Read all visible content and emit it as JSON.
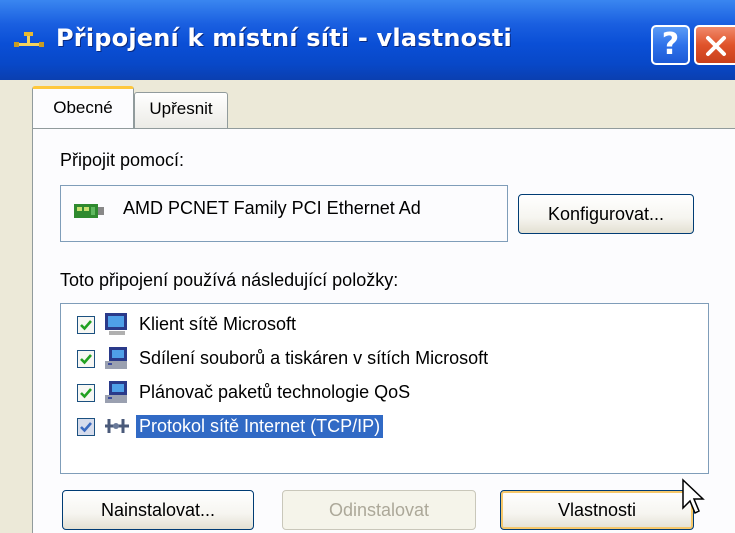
{
  "window": {
    "title": "Připojení k místní síti - vlastnosti",
    "help_label": "?",
    "close_label": "✕"
  },
  "tabs": [
    {
      "label": "Obecné",
      "active": true
    },
    {
      "label": "Upřesnit",
      "active": false
    }
  ],
  "general": {
    "connect_using_label": "Připojit pomocí:",
    "adapter_name": "AMD PCNET Family PCI Ethernet Ad",
    "configure_label": "Konfigurovat...",
    "items_label": "Toto připojení používá následující položky:",
    "items": [
      {
        "label": "Klient sítě Microsoft",
        "checked": true,
        "icon": "network-client-icon"
      },
      {
        "label": "Sdílení souborů a tiskáren v sítích Microsoft",
        "checked": true,
        "icon": "file-printer-sharing-icon"
      },
      {
        "label": "Plánovač paketů technologie QoS",
        "checked": true,
        "icon": "service-icon"
      },
      {
        "label": "Protokol sítě Internet (TCP/IP)",
        "checked": true,
        "icon": "protocol-icon",
        "selected": true
      }
    ],
    "install_label": "Nainstalovat...",
    "uninstall_label": "Odinstalovat",
    "properties_label": "Vlastnosti"
  },
  "colors": {
    "titlebar": "#0a4fd6",
    "selection": "#316ac5",
    "dialog_bg": "#ece9d8",
    "close": "#e0532a"
  }
}
